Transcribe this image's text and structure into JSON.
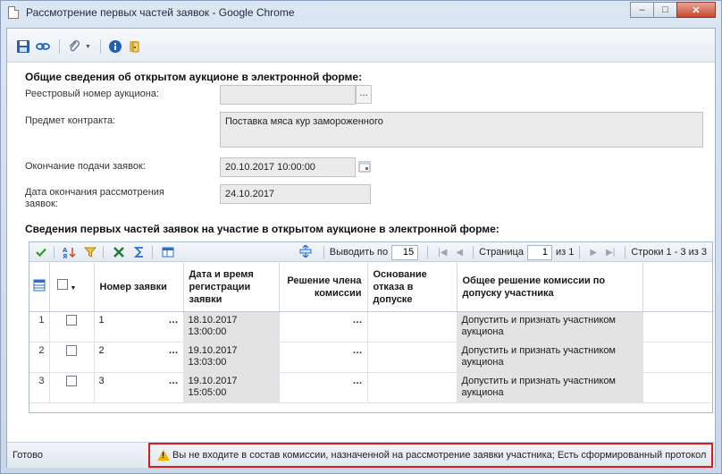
{
  "window": {
    "title": "Рассмотрение первых частей заявок - Google Chrome",
    "minimize": "–",
    "maximize": "□",
    "close": "✕"
  },
  "section1": {
    "title": "Общие сведения об открытом аукционе в электронной форме:",
    "registry_label": "Реестровый номер аукциона:",
    "registry_value": "",
    "subject_label": "Предмет контракта:",
    "subject_value": "Поставка мяса кур замороженного",
    "deadline_label": "Окончание подачи заявок:",
    "deadline_value": "20.10.2017 10:00:00",
    "review_label": "Дата окончания рассмотрения заявок:",
    "review_value": "24.10.2017"
  },
  "section2": {
    "title": "Сведения первых частей заявок на участие в открытом аукционе в электронной форме:"
  },
  "pager": {
    "show_label": "Выводить по",
    "show_value": "15",
    "page_label": "Страница",
    "page_value": "1",
    "of_label": "из 1",
    "rows_label": "Строки 1 - 3 из 3"
  },
  "grid": {
    "columns": [
      "Номер заявки",
      "Дата и время регистрации заявки",
      "Решение члена комиссии",
      "Основание отказа в допуске",
      "Общее решение комиссии по допуску участника"
    ],
    "rows": [
      {
        "n": "1",
        "number": "1",
        "date": "18.10.2017 13:00:00",
        "decision": "",
        "reason": "",
        "general": "Допустить и признать участником аукциона"
      },
      {
        "n": "2",
        "number": "2",
        "date": "19.10.2017 13:03:00",
        "decision": "",
        "reason": "",
        "general": "Допустить и признать участником аукциона"
      },
      {
        "n": "3",
        "number": "3",
        "date": "19.10.2017 15:05:00",
        "decision": "",
        "reason": "",
        "general": "Допустить и признать участником аукциона"
      }
    ]
  },
  "status": {
    "text": "Готово",
    "warning": "Вы не входите в состав комиссии, назначенной на рассмотрение заявки участника; Есть сформированный протокол"
  },
  "colors": {
    "warning_border": "#d81b1b",
    "field_bg": "#ebebeb"
  }
}
